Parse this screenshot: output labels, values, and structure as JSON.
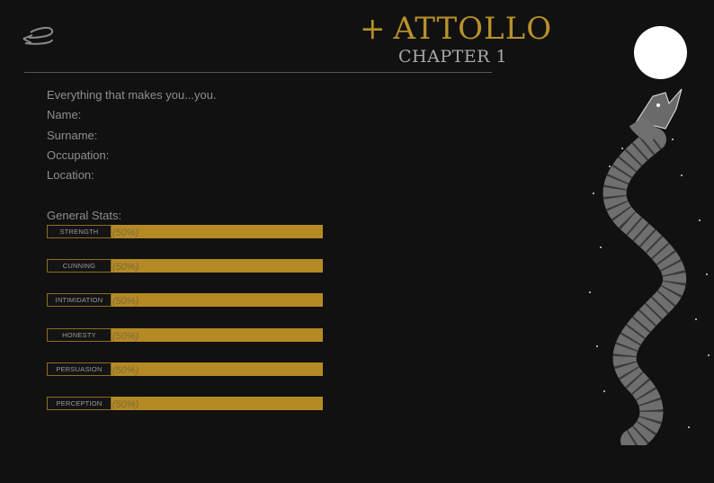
{
  "header": {
    "title": "ATTOLLO",
    "title_prefix": "+",
    "chapter": "CHAPTER 1"
  },
  "profile": {
    "intro": "Everything that makes you...you.",
    "fields": [
      "Name:",
      "Surname:",
      "Occupation:",
      "Location:"
    ]
  },
  "stats": {
    "heading": "General Stats:",
    "items": [
      {
        "label": "STRENGTH",
        "percent_text": "(50%)",
        "value": 0.5
      },
      {
        "label": "CUNNING",
        "percent_text": "(50%)",
        "value": 0.5
      },
      {
        "label": "INTIMIDATION",
        "percent_text": "(50%)",
        "value": 0.5
      },
      {
        "label": "HONESTY",
        "percent_text": "(50%)",
        "value": 0.5
      },
      {
        "label": "PERSUASION",
        "percent_text": "(50%)",
        "value": 0.5
      },
      {
        "label": "PERCEPTION",
        "percent_text": "(50%)",
        "value": 0.5
      }
    ]
  },
  "colors": {
    "accent": "#b8912a",
    "bar": "#b58a24",
    "background": "#111111"
  },
  "icons": {
    "back": "back-arrow-icon",
    "moon": "moon-icon",
    "illustration": "snake-illustration"
  }
}
